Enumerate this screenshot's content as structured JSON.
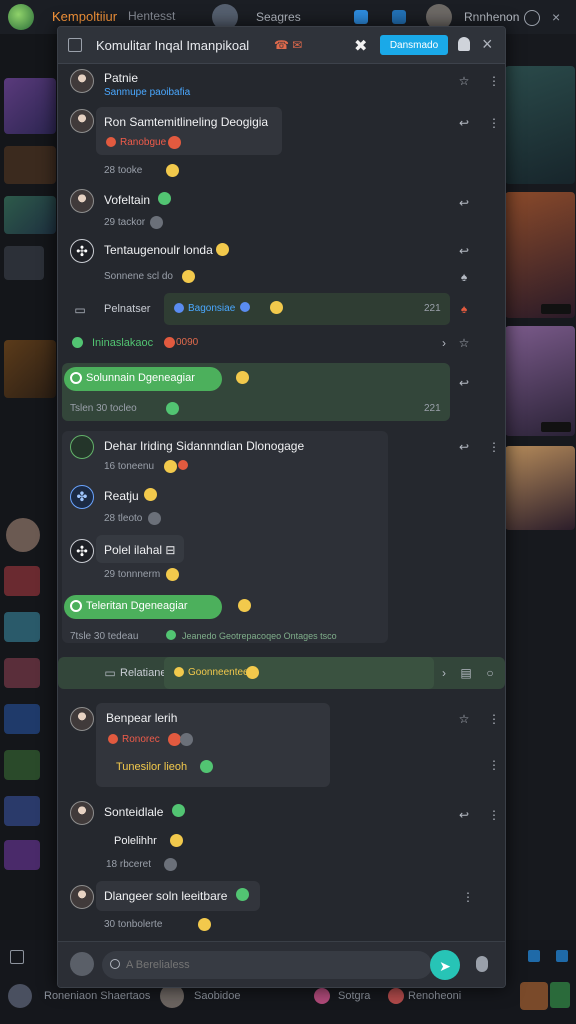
{
  "app": {
    "brand": "Kempoltiiur",
    "brand_secondary": "Hentesst",
    "top_user_a": "Seagres",
    "top_user_b": "Rnnhenon"
  },
  "bottom_bar": {
    "items": [
      "Roneniaon Shaertaos",
      "Saobidoe",
      "Sotgra",
      "Renoheoni"
    ]
  },
  "panel": {
    "title": "Komulitar Inqal Imanpikoal",
    "cta_label": "Dansmado",
    "close_glyph": "×",
    "messages": [
      {
        "name": "Patnie",
        "sub": "Sanmupe paoibafia"
      },
      {
        "name": "Ron Samtemitlineling Deogigia",
        "sub": "Ranobgue",
        "meta": "28 tooke"
      },
      {
        "name": "Vofeltain",
        "meta": "29 tackor"
      },
      {
        "name": "Tentaugenoulr londa",
        "meta": "Sonnene  scl do"
      },
      {
        "name": "Pelnatser",
        "chip": "Bagonsiae",
        "time": "221"
      },
      {
        "name": "Ininaslakaoc",
        "chip": "0090"
      },
      {
        "pill": "Solunnain Dgeneagiar",
        "meta": "Tslen  30 tocleo",
        "time": "221"
      },
      {
        "name": "Dehar Iriding Sidannndian Dlonogage",
        "meta": "16 toneenu"
      },
      {
        "name": "Reatju",
        "meta": "28 tleoto"
      },
      {
        "name": "Polel ilahal ⊟",
        "meta": "29 tonnnerm"
      },
      {
        "pill": "Teleritan Dgeneagiar",
        "meta": "7tsle  30 tedeau",
        "chip": "Jeanedo Geotrepacoqeo  Ontages  tsco"
      },
      {
        "name": "Relatiane",
        "chip": "Goonneentees"
      },
      {
        "name": "Benpear lerih",
        "sub": "Ronorec",
        "extra": "Tunesilor lieoh"
      },
      {
        "name": "Sonteidlale",
        "extra": "Polelihhr",
        "meta": "18 rbceret"
      },
      {
        "name": "Dlangeer soln leeitbare",
        "meta": "30 tonbolerte"
      }
    ]
  },
  "composer": {
    "placeholder": "A Berelialess"
  }
}
